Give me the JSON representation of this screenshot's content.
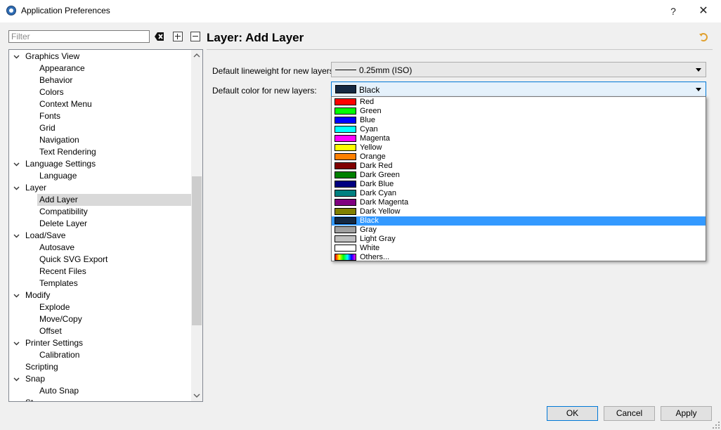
{
  "window": {
    "title": "Application Preferences",
    "help_glyph": "?",
    "close_glyph": "✕"
  },
  "sidebar": {
    "filter_placeholder": "Filter",
    "filter_value": "",
    "tree": [
      {
        "label": "Graphics View",
        "level": 0,
        "expanded": true
      },
      {
        "label": "Appearance",
        "level": 1
      },
      {
        "label": "Behavior",
        "level": 1
      },
      {
        "label": "Colors",
        "level": 1
      },
      {
        "label": "Context Menu",
        "level": 1
      },
      {
        "label": "Fonts",
        "level": 1
      },
      {
        "label": "Grid",
        "level": 1
      },
      {
        "label": "Navigation",
        "level": 1
      },
      {
        "label": "Text Rendering",
        "level": 1
      },
      {
        "label": "Language Settings",
        "level": 0,
        "expanded": true
      },
      {
        "label": "Language",
        "level": 1
      },
      {
        "label": "Layer",
        "level": 0,
        "expanded": true
      },
      {
        "label": "Add Layer",
        "level": 1,
        "selected": true
      },
      {
        "label": "Compatibility",
        "level": 1
      },
      {
        "label": "Delete Layer",
        "level": 1
      },
      {
        "label": "Load/Save",
        "level": 0,
        "expanded": true
      },
      {
        "label": "Autosave",
        "level": 1
      },
      {
        "label": "Quick SVG Export",
        "level": 1
      },
      {
        "label": "Recent Files",
        "level": 1
      },
      {
        "label": "Templates",
        "level": 1
      },
      {
        "label": "Modify",
        "level": 0,
        "expanded": true
      },
      {
        "label": "Explode",
        "level": 1
      },
      {
        "label": "Move/Copy",
        "level": 1
      },
      {
        "label": "Offset",
        "level": 1
      },
      {
        "label": "Printer Settings",
        "level": 0,
        "expanded": true
      },
      {
        "label": "Calibration",
        "level": 1
      },
      {
        "label": "Scripting",
        "level": 0,
        "expanded": false
      },
      {
        "label": "Snap",
        "level": 0,
        "expanded": true
      },
      {
        "label": "Auto Snap",
        "level": 1
      },
      {
        "label": "St...",
        "level": 0,
        "expanded": false
      }
    ]
  },
  "page": {
    "title": "Layer: Add Layer",
    "lineweight_label": "Default lineweight for new layers:",
    "lineweight_value": "0.25mm (ISO)",
    "color_label": "Default color for new layers:",
    "color_value": "Black"
  },
  "color_options": [
    {
      "label": "Red",
      "color": "#ff0000"
    },
    {
      "label": "Green",
      "color": "#00ff00"
    },
    {
      "label": "Blue",
      "color": "#0000ff"
    },
    {
      "label": "Cyan",
      "color": "#00ffff"
    },
    {
      "label": "Magenta",
      "color": "#ff00ff"
    },
    {
      "label": "Yellow",
      "color": "#ffff00"
    },
    {
      "label": "Orange",
      "color": "#ff8000"
    },
    {
      "label": "Dark Red",
      "color": "#800000"
    },
    {
      "label": "Dark Green",
      "color": "#008000"
    },
    {
      "label": "Dark Blue",
      "color": "#000080"
    },
    {
      "label": "Dark Cyan",
      "color": "#008080"
    },
    {
      "label": "Dark Magenta",
      "color": "#800080"
    },
    {
      "label": "Dark Yellow",
      "color": "#808000"
    },
    {
      "label": "Black",
      "color": "#142842",
      "selected": true
    },
    {
      "label": "Gray",
      "color": "#a0a0a0"
    },
    {
      "label": "Light Gray",
      "color": "#c0c0c0"
    },
    {
      "label": "White",
      "color": "#ffffff"
    },
    {
      "label": "Others...",
      "color": "rainbow"
    }
  ],
  "buttons": {
    "ok": "OK",
    "cancel": "Cancel",
    "apply": "Apply"
  },
  "colors": {
    "accent": "#0078d7",
    "selection": "#3399ff",
    "tree_selection": "#d9d9d9"
  }
}
